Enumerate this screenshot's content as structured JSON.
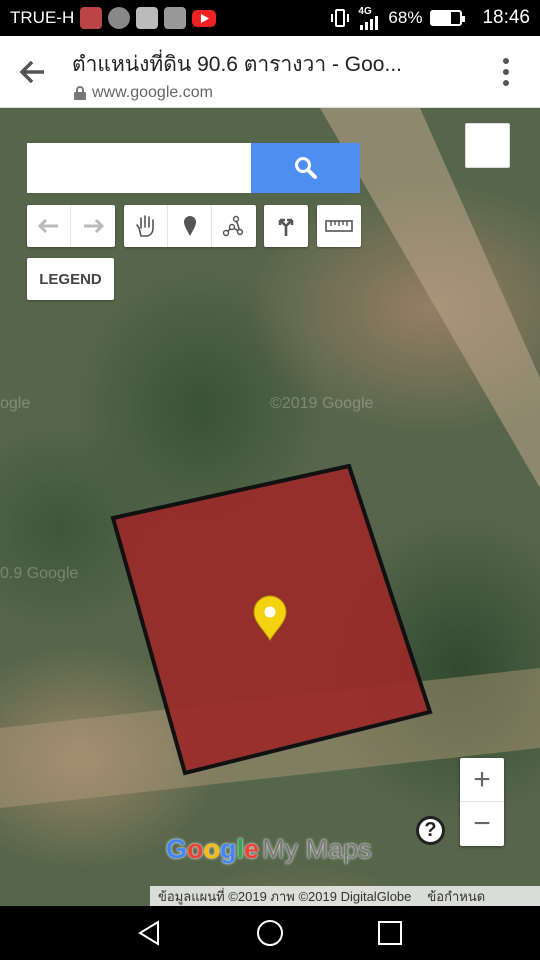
{
  "status_bar": {
    "carrier": "TRUE-H",
    "network": "4G",
    "battery_level": "68%",
    "battery_fraction": 0.68,
    "time": "18:46",
    "notification_icons": [
      "contact-avatar-icon",
      "settings-icon",
      "gallery-icon",
      "profile-icon",
      "youtube-icon"
    ]
  },
  "browser": {
    "title": "ตำแหน่งที่ดิน 90.6 ตารางวา - Goo...",
    "url": "www.google.com"
  },
  "map": {
    "search_placeholder": "",
    "legend_label": "LEGEND",
    "zoom_in_label": "+",
    "zoom_out_label": "−",
    "help_label": "?",
    "logo_google": [
      "G",
      "o",
      "o",
      "g",
      "l",
      "e"
    ],
    "logo_google_colors": [
      "#4285F4",
      "#EA4335",
      "#FBBC05",
      "#4285F4",
      "#34A853",
      "#EA4335"
    ],
    "logo_suffix": "My Maps",
    "attribution": "ข้อมูลแผนที่ ©2019 ภาพ ©2019 DigitalGlobe",
    "terms": "ข้อกำหนด",
    "polygon_fill": "#9a2a28",
    "pin_color": "#f5d20f",
    "watermark": "©2019 Google"
  },
  "colors": {
    "search_button": "#4d8ff0"
  }
}
